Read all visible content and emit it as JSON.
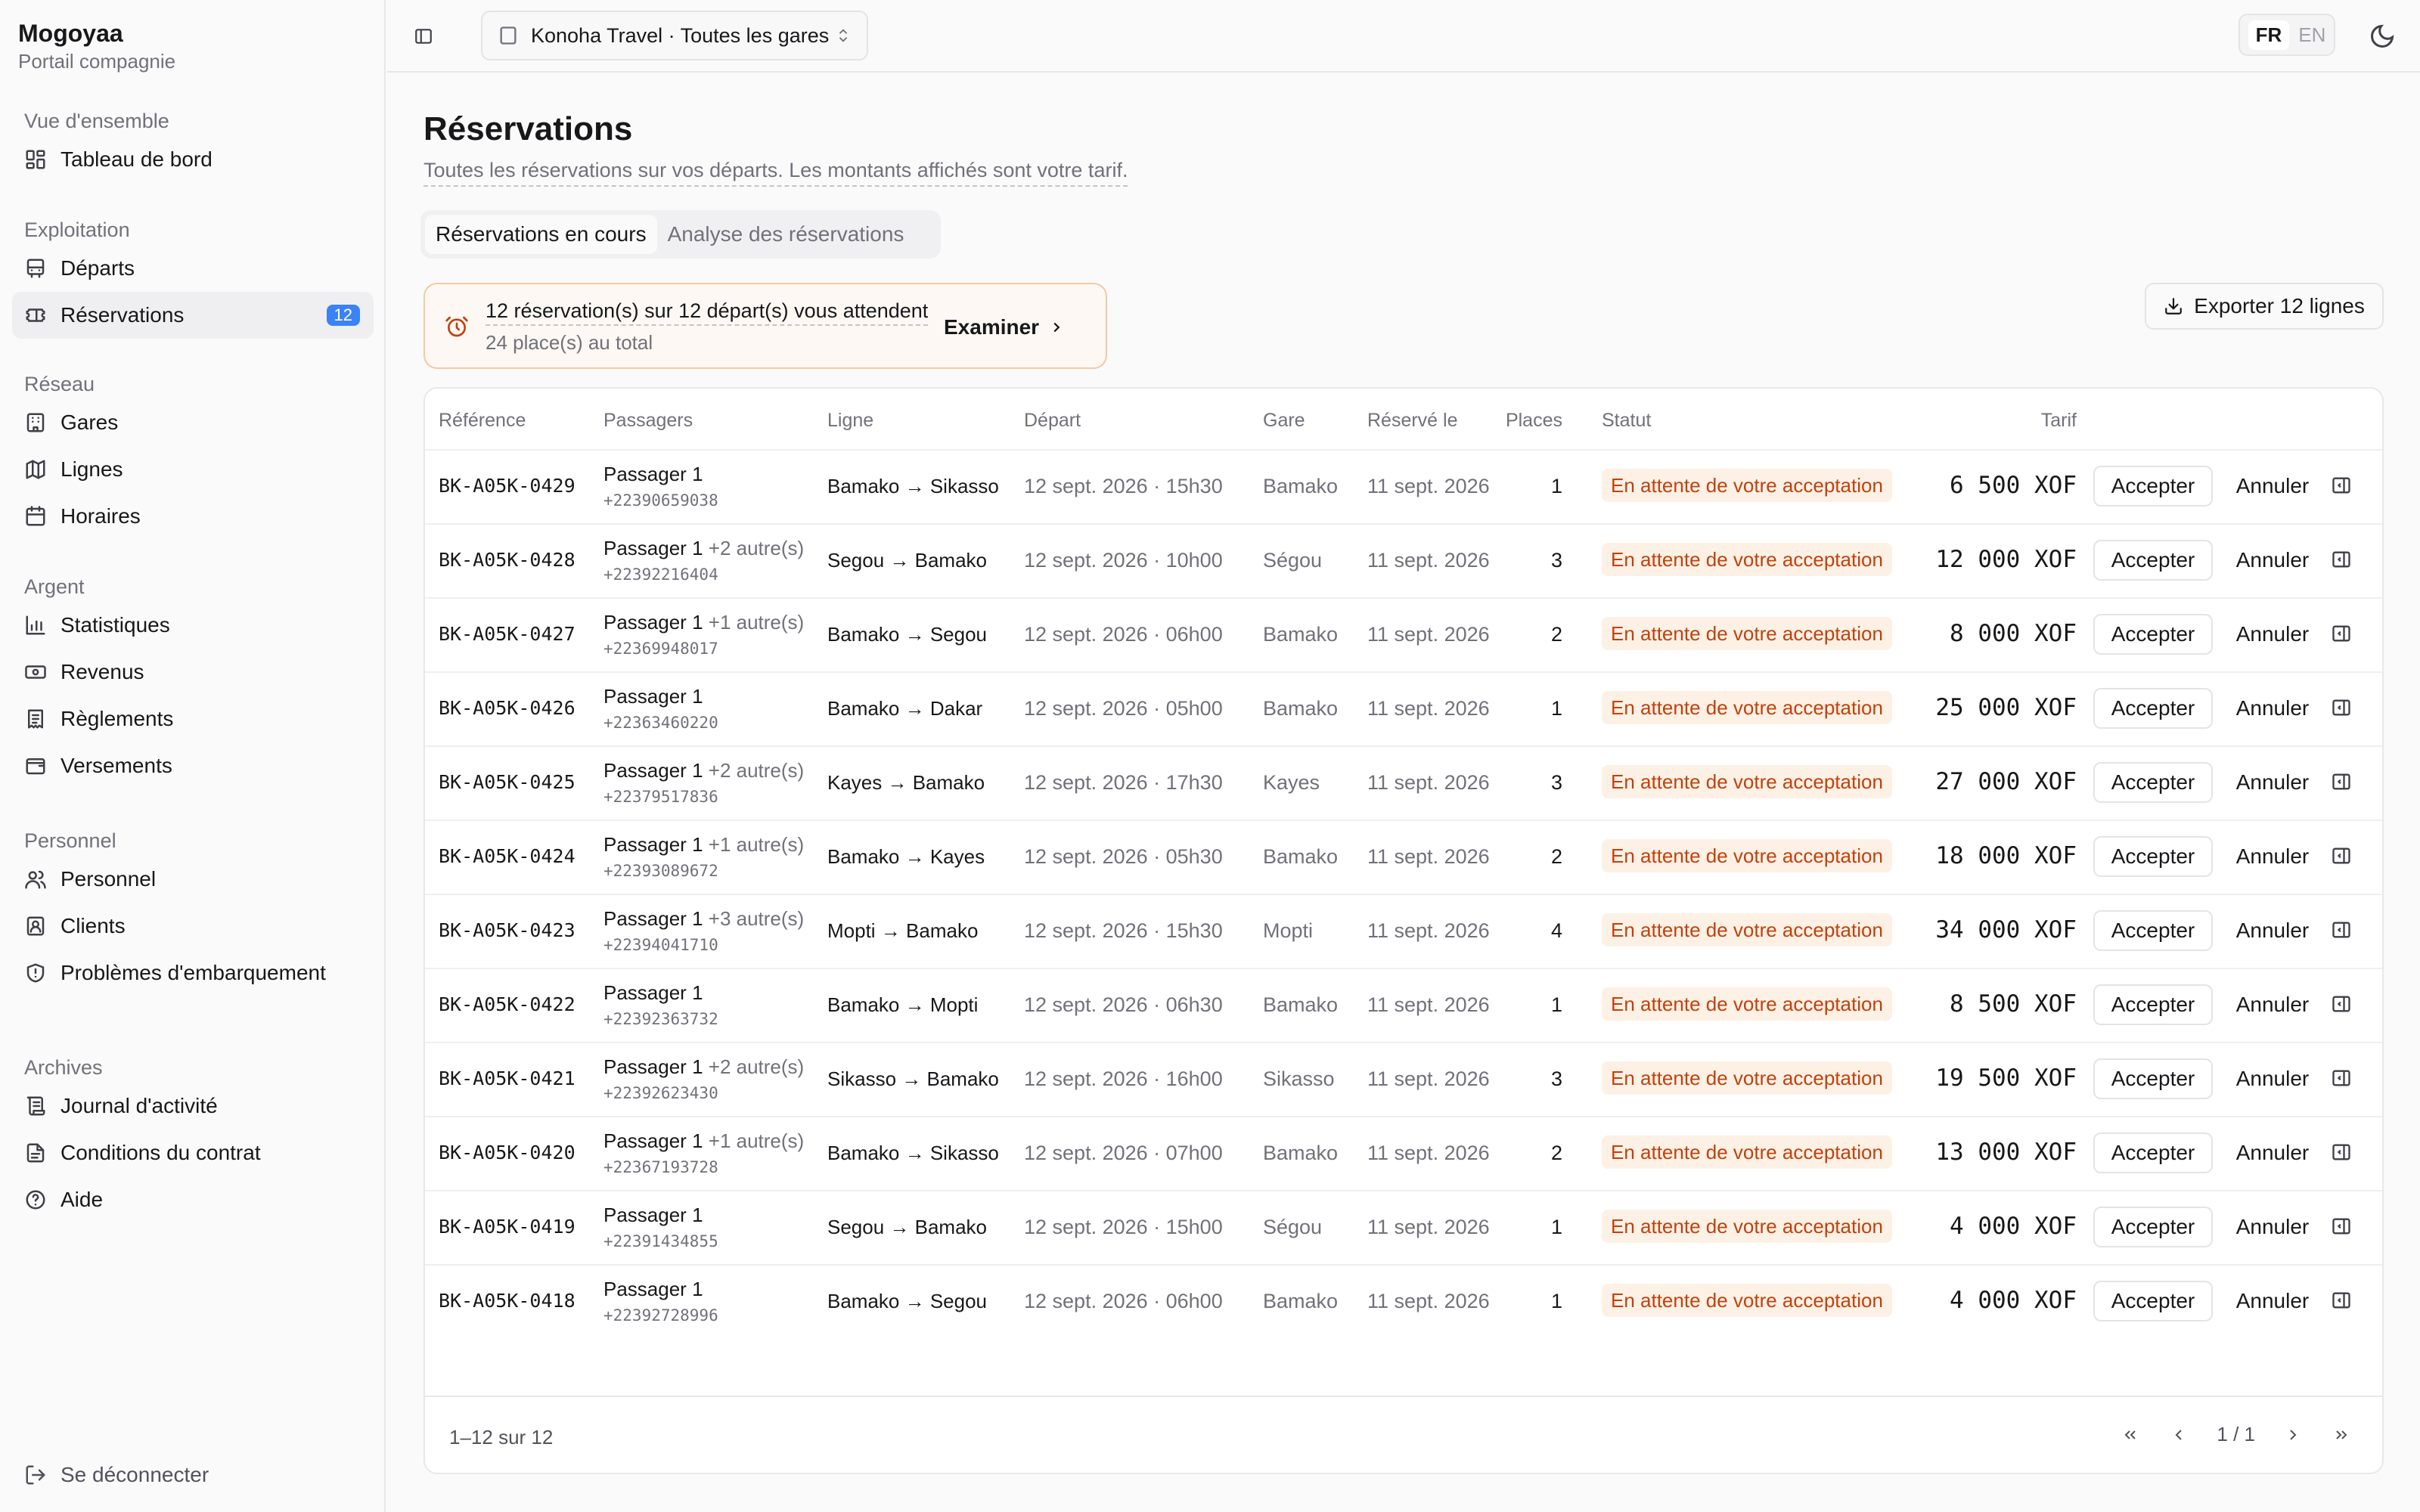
{
  "brand": {
    "title": "Mogoyaa",
    "subtitle": "Portail compagnie"
  },
  "sidebar": {
    "groups": [
      {
        "label": "Vue d'ensemble",
        "items": [
          {
            "label": "Tableau de bord",
            "icon": "dashboard-icon"
          }
        ]
      },
      {
        "label": "Exploitation",
        "items": [
          {
            "label": "Départs",
            "icon": "bus-icon"
          },
          {
            "label": "Réservations",
            "icon": "ticket-icon",
            "badge": "12",
            "active": true
          }
        ]
      },
      {
        "label": "Réseau",
        "items": [
          {
            "label": "Gares",
            "icon": "building-icon"
          },
          {
            "label": "Lignes",
            "icon": "map-icon"
          },
          {
            "label": "Horaires",
            "icon": "calendar-icon"
          }
        ]
      },
      {
        "label": "Argent",
        "items": [
          {
            "label": "Statistiques",
            "icon": "bar-chart-icon"
          },
          {
            "label": "Revenus",
            "icon": "banknote-icon"
          },
          {
            "label": "Règlements",
            "icon": "receipt-icon"
          },
          {
            "label": "Versements",
            "icon": "wallet-icon"
          }
        ]
      },
      {
        "label": "Personnel",
        "items": [
          {
            "label": "Personnel",
            "icon": "users-icon"
          },
          {
            "label": "Clients",
            "icon": "contact-icon"
          },
          {
            "label": "Problèmes d'embarquement",
            "icon": "shield-icon"
          }
        ]
      },
      {
        "label": "Archives",
        "items": [
          {
            "label": "Journal d'activité",
            "icon": "scroll-icon"
          },
          {
            "label": "Conditions du contrat",
            "icon": "file-text-icon"
          },
          {
            "label": "Aide",
            "icon": "help-circle-icon"
          }
        ]
      }
    ],
    "logout": "Se déconnecter"
  },
  "topbar": {
    "company": "Konoha Travel · Toutes les gares",
    "lang_fr": "FR",
    "lang_en": "EN"
  },
  "page": {
    "title": "Réservations",
    "subtitle": "Toutes les réservations sur vos départs. Les montants affichés sont votre tarif.",
    "tabs": [
      {
        "label": "Réservations en cours",
        "active": true
      },
      {
        "label": "Analyse des réservations",
        "active": false
      }
    ]
  },
  "alert": {
    "title": "12 réservation(s) sur 12 départ(s) vous attendent",
    "subtitle": "24 place(s) au total",
    "action": "Examiner"
  },
  "export_label": "Exporter 12 lignes",
  "table": {
    "headers": {
      "reference": "Référence",
      "passagers": "Passagers",
      "ligne": "Ligne",
      "depart": "Départ",
      "gare": "Gare",
      "reserve": "Réservé le",
      "places": "Places",
      "statut": "Statut",
      "tarif": "Tarif"
    },
    "accept_label": "Accepter",
    "cancel_label": "Annuler",
    "rows": [
      {
        "ref": "BK-A05K-0429",
        "passenger": "Passager 1",
        "extra": "",
        "phone": "+22390659038",
        "ligne": "Bamako → Sikasso",
        "depart": "12 sept. 2026 · 15h30",
        "gare": "Bamako",
        "reserve": "11 sept. 2026",
        "places": "1",
        "statut": "En attente de votre acceptation",
        "tarif": "6 500  XOF"
      },
      {
        "ref": "BK-A05K-0428",
        "passenger": "Passager 1",
        "extra": " +2 autre(s)",
        "phone": "+22392216404",
        "ligne": "Segou → Bamako",
        "depart": "12 sept. 2026 · 10h00",
        "gare": "Ségou",
        "reserve": "11 sept. 2026",
        "places": "3",
        "statut": "En attente de votre acceptation",
        "tarif": "12 000  XOF"
      },
      {
        "ref": "BK-A05K-0427",
        "passenger": "Passager 1",
        "extra": " +1 autre(s)",
        "phone": "+22369948017",
        "ligne": "Bamako → Segou",
        "depart": "12 sept. 2026 · 06h00",
        "gare": "Bamako",
        "reserve": "11 sept. 2026",
        "places": "2",
        "statut": "En attente de votre acceptation",
        "tarif": "8 000  XOF"
      },
      {
        "ref": "BK-A05K-0426",
        "passenger": "Passager 1",
        "extra": "",
        "phone": "+22363460220",
        "ligne": "Bamako → Dakar",
        "depart": "12 sept. 2026 · 05h00",
        "gare": "Bamako",
        "reserve": "11 sept. 2026",
        "places": "1",
        "statut": "En attente de votre acceptation",
        "tarif": "25 000  XOF"
      },
      {
        "ref": "BK-A05K-0425",
        "passenger": "Passager 1",
        "extra": " +2 autre(s)",
        "phone": "+22379517836",
        "ligne": "Kayes → Bamako",
        "depart": "12 sept. 2026 · 17h30",
        "gare": "Kayes",
        "reserve": "11 sept. 2026",
        "places": "3",
        "statut": "En attente de votre acceptation",
        "tarif": "27 000  XOF"
      },
      {
        "ref": "BK-A05K-0424",
        "passenger": "Passager 1",
        "extra": " +1 autre(s)",
        "phone": "+22393089672",
        "ligne": "Bamako → Kayes",
        "depart": "12 sept. 2026 · 05h30",
        "gare": "Bamako",
        "reserve": "11 sept. 2026",
        "places": "2",
        "statut": "En attente de votre acceptation",
        "tarif": "18 000  XOF"
      },
      {
        "ref": "BK-A05K-0423",
        "passenger": "Passager 1",
        "extra": " +3 autre(s)",
        "phone": "+22394041710",
        "ligne": "Mopti → Bamako",
        "depart": "12 sept. 2026 · 15h30",
        "gare": "Mopti",
        "reserve": "11 sept. 2026",
        "places": "4",
        "statut": "En attente de votre acceptation",
        "tarif": "34 000  XOF"
      },
      {
        "ref": "BK-A05K-0422",
        "passenger": "Passager 1",
        "extra": "",
        "phone": "+22392363732",
        "ligne": "Bamako → Mopti",
        "depart": "12 sept. 2026 · 06h30",
        "gare": "Bamako",
        "reserve": "11 sept. 2026",
        "places": "1",
        "statut": "En attente de votre acceptation",
        "tarif": "8 500  XOF"
      },
      {
        "ref": "BK-A05K-0421",
        "passenger": "Passager 1",
        "extra": " +2 autre(s)",
        "phone": "+22392623430",
        "ligne": "Sikasso → Bamako",
        "depart": "12 sept. 2026 · 16h00",
        "gare": "Sikasso",
        "reserve": "11 sept. 2026",
        "places": "3",
        "statut": "En attente de votre acceptation",
        "tarif": "19 500  XOF"
      },
      {
        "ref": "BK-A05K-0420",
        "passenger": "Passager 1",
        "extra": " +1 autre(s)",
        "phone": "+22367193728",
        "ligne": "Bamako → Sikasso",
        "depart": "12 sept. 2026 · 07h00",
        "gare": "Bamako",
        "reserve": "11 sept. 2026",
        "places": "2",
        "statut": "En attente de votre acceptation",
        "tarif": "13 000  XOF"
      },
      {
        "ref": "BK-A05K-0419",
        "passenger": "Passager 1",
        "extra": "",
        "phone": "+22391434855",
        "ligne": "Segou → Bamako",
        "depart": "12 sept. 2026 · 15h00",
        "gare": "Ségou",
        "reserve": "11 sept. 2026",
        "places": "1",
        "statut": "En attente de votre acceptation",
        "tarif": "4 000  XOF"
      },
      {
        "ref": "BK-A05K-0418",
        "passenger": "Passager 1",
        "extra": "",
        "phone": "+22392728996",
        "ligne": "Bamako → Segou",
        "depart": "12 sept. 2026 · 06h00",
        "gare": "Bamako",
        "reserve": "11 sept. 2026",
        "places": "1",
        "statut": "En attente de votre acceptation",
        "tarif": "4 000  XOF"
      }
    ]
  },
  "footer": {
    "range": "1–12 sur 12",
    "page": "1 / 1"
  },
  "colors": {
    "accent": "#3b82f6",
    "status_bg": "#fdf1e6",
    "status_text": "#c2410c",
    "alert_border": "#f5c9a0"
  }
}
